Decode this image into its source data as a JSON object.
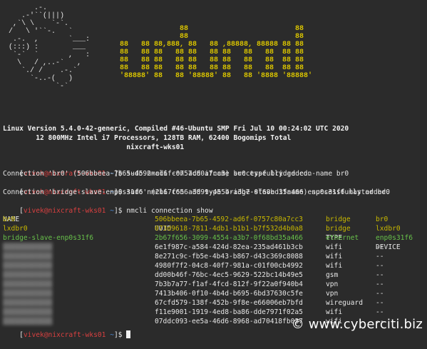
{
  "logo": {
    "art": "       .-.\n    .-'``(|||)\n  ,`\\ \\    `-`.\n /   \\ '``-.   `\n  .-.  ,       `___:\n (:::) :        ___\n  `-`  `       ,   :\n   \\   / ,..-`   ,\n    `./ /    .-.`\n      `-..-(   )\n            `-`",
    "banner": "              88                         88\n              88                         88\n88   88 88,888, 88   88 ,88888, 88888 88 88\n88   88 88   88 88   88 88   88   88  88 88\n88   88 88   88 88   88 88   88   88  88 88\n88   88 88   88 88   88 88   88   88  88 88\n'88888' 88   88 '88888' 88   88 '8888 '88888'"
  },
  "sysinfo": {
    "line1": "Linux Version 5.4.0-42-generic, Compiled #46-Ubuntu SMP Fri Jul 10 00:24:02 UTC 2020",
    "line2": "        12 800MHz Intel i7 Processors, 128TB RAM, 62400 Bogomips Total",
    "line3": "                              nixcraft-wks01"
  },
  "prompt": {
    "open": "[",
    "user_host": "vivek@nixcraft-wks01",
    "sep": " ",
    "tilde": "~",
    "close": "]$ "
  },
  "commands": [
    {
      "cmd": "sudo nmcli con add ifname br0 type bridge con-name br0",
      "out": "Connection 'br0' (506bbeea-7b65-4592-ad6f-0757c80a7cc3) successfully added."
    },
    {
      "cmd": "sudo nmcli con add type bridge-slave ifname enp0s31f6 master br0",
      "out": "Connection 'bridge-slave-enp0s31f6' (2b67f656-3099-4554-a3b7-0f68bd35a466) successfully added."
    },
    {
      "cmd": "nmcli connection show",
      "out": ""
    }
  ],
  "table": {
    "headers": {
      "name": "NAME",
      "uuid": "UUID",
      "type": "TYPE",
      "device": "DEVICE"
    },
    "rows": [
      {
        "name": "br0",
        "uuid": "506bbeea-7b65-4592-ad6f-0757c80a7cc3",
        "type": "bridge",
        "device": "br0",
        "color": "#c8b800",
        "blur": false
      },
      {
        "name": "lxdbr0",
        "uuid": "073d9618-7811-4db1-b1b1-b7f532d4b0a8",
        "type": "bridge",
        "device": "lxdbr0",
        "color": "#c8b800",
        "blur": false
      },
      {
        "name": "bridge-slave-enp0s31f6",
        "uuid": "2b67f656-3099-4554-a3b7-0f68bd35a466",
        "type": "ethernet",
        "device": "enp0s31f6",
        "color": "#67c04a",
        "blur": false
      },
      {
        "name": "",
        "uuid": "6e1f987c-a584-424d-82ea-235ad461b3cb",
        "type": "wifi",
        "device": "--",
        "color": "#e6e6e6",
        "blur": true
      },
      {
        "name": "",
        "uuid": "8e271c9c-fb5e-4b43-b867-d43c369c8088",
        "type": "wifi",
        "device": "--",
        "color": "#e6e6e6",
        "blur": true
      },
      {
        "name": "",
        "uuid": "4980f7f2-04c8-40f7-981a-c01f00cb4992",
        "type": "wifi",
        "device": "--",
        "color": "#e6e6e6",
        "blur": true
      },
      {
        "name": "",
        "uuid": "dd00b46f-76bc-4ec5-9629-522bc14b49e5",
        "type": "gsm",
        "device": "--",
        "color": "#e6e6e6",
        "blur": true
      },
      {
        "name": "",
        "uuid": "7b3b7a77-f1af-4fcd-812f-9f22a0f940b4",
        "type": "vpn",
        "device": "--",
        "color": "#e6e6e6",
        "blur": true
      },
      {
        "name": "",
        "uuid": "7413b406-0f10-4b4d-b695-6bd37630c5fe",
        "type": "vpn",
        "device": "--",
        "color": "#e6e6e6",
        "blur": true
      },
      {
        "name": "",
        "uuid": "67cfd579-138f-452b-9f8e-e66006eb7bfd",
        "type": "wireguard",
        "device": "--",
        "color": "#e6e6e6",
        "blur": true
      },
      {
        "name": "",
        "uuid": "f11e9001-1919-4ed8-ba86-dde7971f02a5",
        "type": "wifi",
        "device": "--",
        "color": "#e6e6e6",
        "blur": true
      },
      {
        "name": "",
        "uuid": "07ddc093-ee5a-46d6-8968-ad70418fb037",
        "type": "wifi",
        "device": "--",
        "color": "#e6e6e6",
        "blur": true
      }
    ]
  },
  "watermark": "© www.cyberciti.biz"
}
